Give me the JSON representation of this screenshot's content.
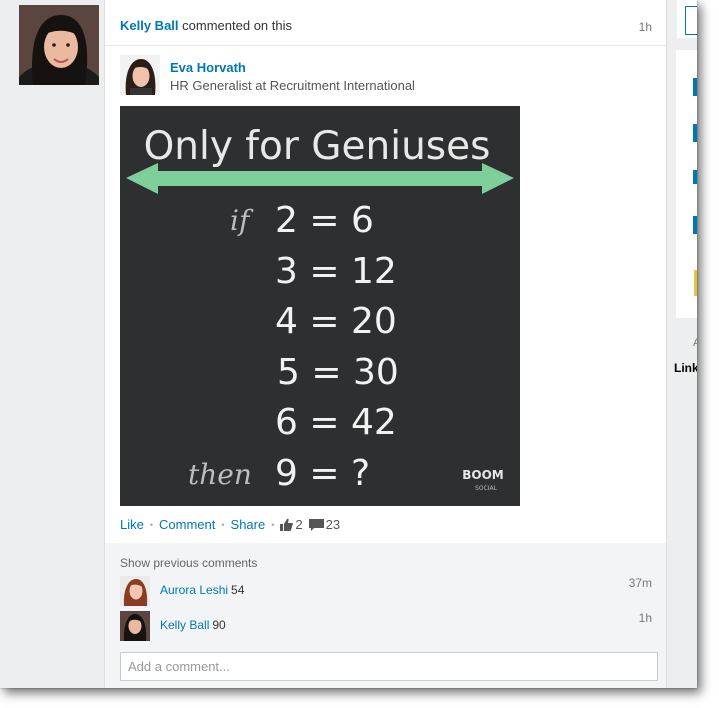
{
  "activity": {
    "actor_name": "Kelly Ball",
    "action_text": "commented on this",
    "time": "1h"
  },
  "post": {
    "author_name": "Eva Horvath",
    "author_title": "HR Generalist at Recruitment International",
    "image": {
      "title": "Only for Geniuses",
      "if_label": "if",
      "then_label": "then",
      "equations": [
        "2 = 6",
        "3 = 12",
        "4 = 20",
        "5 = 30",
        "6 = 42",
        "9 = ?"
      ],
      "logo_text": "BOOM",
      "logo_sub": "SOCIAL"
    },
    "actions": {
      "like": "Like",
      "comment": "Comment",
      "share": "Share",
      "likes_count": "2",
      "comments_count": "23"
    }
  },
  "comments": {
    "show_previous": "Show previous comments",
    "items": [
      {
        "name": "Aurora Leshi",
        "text": "54",
        "time": "37m"
      },
      {
        "name": "Kelly Ball",
        "text": "90",
        "time": "1h"
      }
    ],
    "add_placeholder": "Add a comment..."
  },
  "right_column": {
    "letter_a": "A",
    "link_fragment": "Link"
  },
  "colors": {
    "link": "#0077b5",
    "image_bg": "#2e2f30",
    "arrow": "#7fcf9a"
  }
}
